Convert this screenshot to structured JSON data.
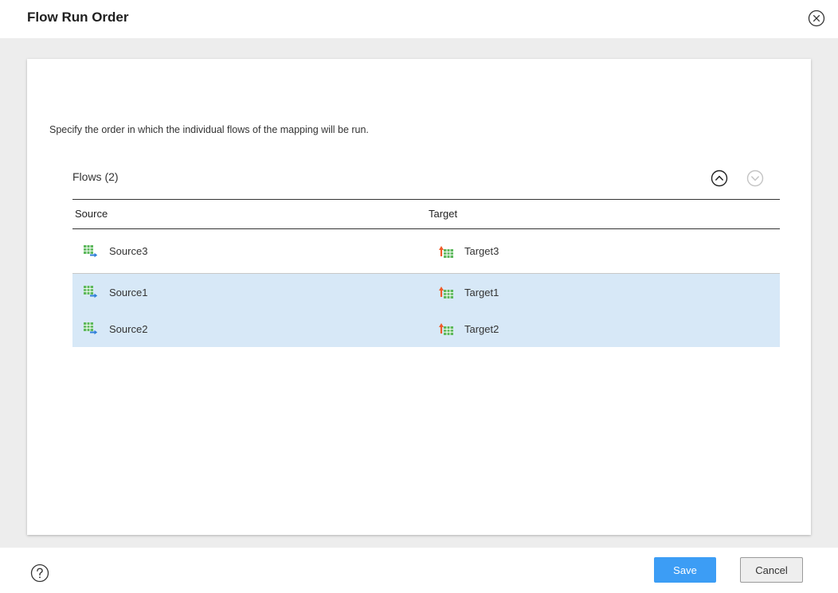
{
  "dialog": {
    "title": "Flow Run Order",
    "close_icon": "close-circle-icon"
  },
  "panel": {
    "description": "Specify the order in which the individual flows of the mapping will be run.",
    "flows_title": "Flows (2)",
    "move_up_icon": "chevron-up-circle-icon",
    "move_down_icon": "chevron-down-circle-icon"
  },
  "table": {
    "columns": [
      "Source",
      "Target"
    ],
    "rows": [
      {
        "source": "Source3",
        "target": "Target3",
        "selected": false
      },
      {
        "source": "Source1",
        "target": "Target1",
        "selected": true
      },
      {
        "source": "Source2",
        "target": "Target2",
        "selected": true
      }
    ]
  },
  "footer": {
    "help_icon": "help-circle-icon",
    "save_label": "Save",
    "cancel_label": "Cancel"
  },
  "colors": {
    "selection": "#d7e8f7",
    "primary_button": "#3c9df5",
    "background": "#ededed"
  }
}
